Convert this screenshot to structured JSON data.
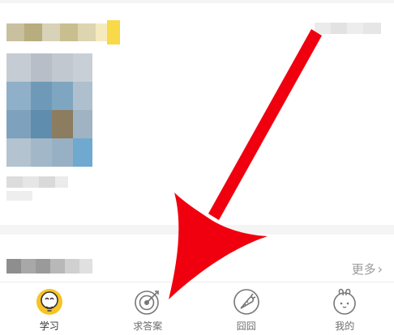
{
  "colors": {
    "accent": "#f7c325",
    "arrow": "#f0000e",
    "tab_text": "#6d6d6d",
    "muted_text": "#9a9a9a"
  },
  "feed": {
    "more_label": "更多",
    "more_icon": "chevron-right-icon"
  },
  "tabbar": {
    "tabs": [
      {
        "label": "学习",
        "icon": "lightbulb-icon",
        "active": true
      },
      {
        "label": "求答案",
        "icon": "target-icon",
        "active": false
      },
      {
        "label": "囧囧",
        "icon": "carrot-icon",
        "active": false
      },
      {
        "label": "我的",
        "icon": "bunny-icon",
        "active": false
      }
    ]
  }
}
